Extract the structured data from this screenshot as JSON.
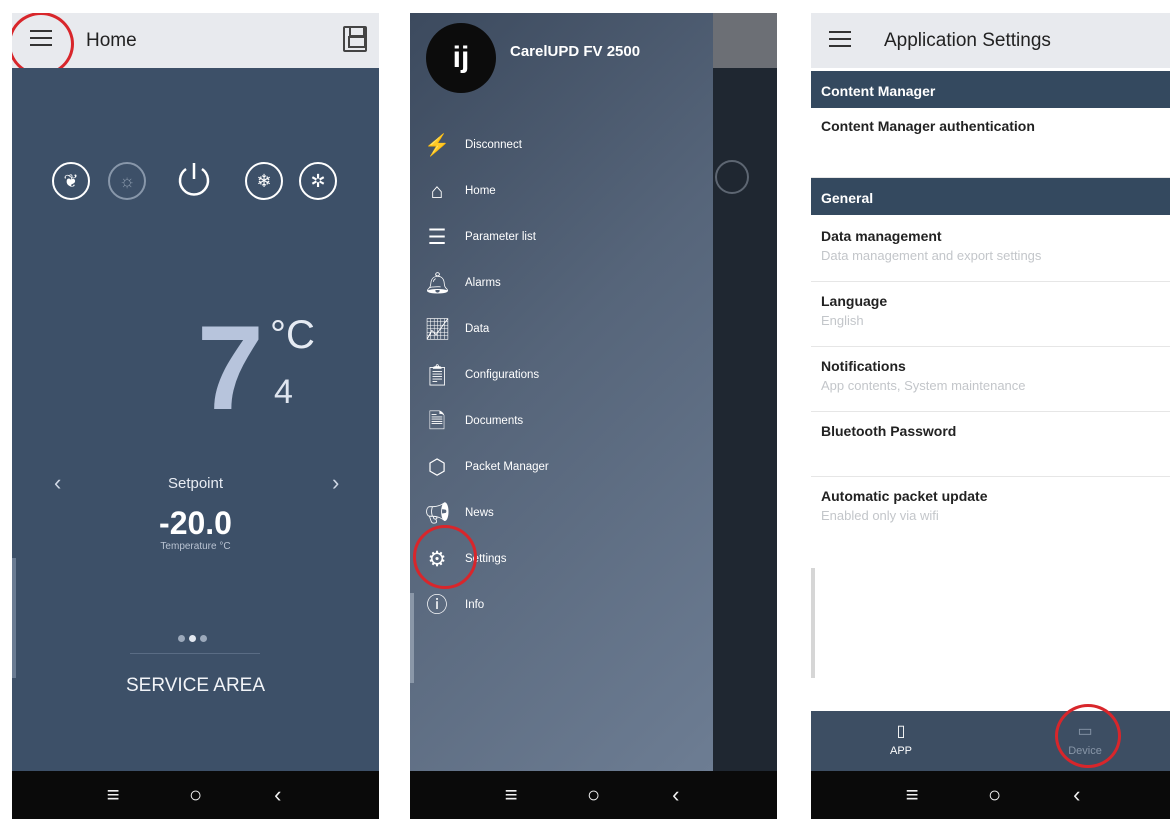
{
  "panel1": {
    "title": "Home",
    "temperature_main": "7",
    "unit": "°C",
    "secondary_value": "4",
    "setpoint_label": "Setpoint",
    "setpoint_value": "-20.0",
    "setpoint_sub": "Temperature °C",
    "service_area": "SERVICE AREA",
    "prev_arrow": "‹",
    "next_arrow": "›"
  },
  "panel2": {
    "device_name": "CarelUPD FV 2500",
    "logo_text": "ij",
    "menu": [
      {
        "label": "Disconnect",
        "icon": "disconnect-icon"
      },
      {
        "label": "Home",
        "icon": "home-icon"
      },
      {
        "label": "Parameter list",
        "icon": "list-icon"
      },
      {
        "label": "Alarms",
        "icon": "bell-icon"
      },
      {
        "label": "Data",
        "icon": "chart-icon"
      },
      {
        "label": "Configurations",
        "icon": "clipboard-icon"
      },
      {
        "label": "Documents",
        "icon": "document-icon"
      },
      {
        "label": "Packet Manager",
        "icon": "package-icon"
      },
      {
        "label": "News",
        "icon": "megaphone-icon"
      },
      {
        "label": "Settings",
        "icon": "gear-icon"
      },
      {
        "label": "Info",
        "icon": "info-icon"
      }
    ]
  },
  "panel3": {
    "title": "Application Settings",
    "section_content": "Content Manager",
    "content_auth": "Content Manager authentication",
    "section_general": "General",
    "settings": [
      {
        "title": "Data management",
        "subtitle": "Data management and export settings"
      },
      {
        "title": "Language",
        "subtitle": "English"
      },
      {
        "title": "Notifications",
        "subtitle": "App contents, System maintenance"
      },
      {
        "title": "Bluetooth Password",
        "subtitle": ""
      },
      {
        "title": "Automatic packet update",
        "subtitle": "Enabled only via wifi"
      }
    ],
    "tab_app": "APP",
    "tab_device": "Device"
  },
  "colors": {
    "home_bg": "#3d5068",
    "section_header": "#34495f",
    "highlight": "#d8262b"
  }
}
